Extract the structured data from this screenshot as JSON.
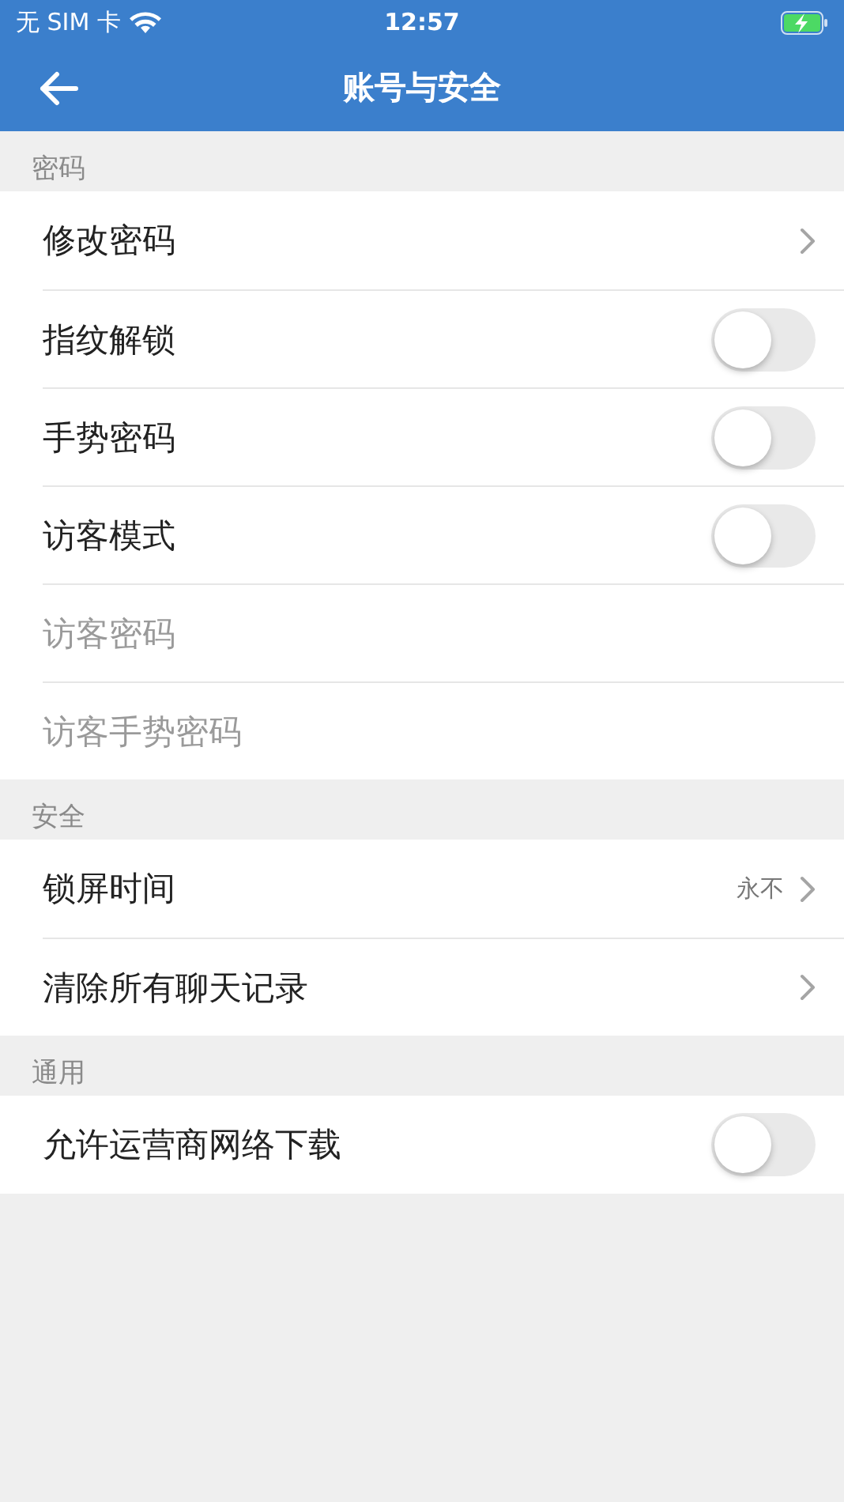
{
  "status_bar": {
    "carrier": "无 SIM 卡",
    "time": "12:57"
  },
  "nav_bar": {
    "title": "账号与安全"
  },
  "sections": [
    {
      "header": "密码",
      "rows": [
        {
          "kind": "link",
          "label": "修改密码",
          "disabled": false
        },
        {
          "kind": "toggle",
          "label": "指纹解锁",
          "on": false,
          "disabled": false
        },
        {
          "kind": "toggle",
          "label": "手势密码",
          "on": false,
          "disabled": false
        },
        {
          "kind": "toggle",
          "label": "访客模式",
          "on": false,
          "disabled": false
        },
        {
          "kind": "plain",
          "label": "访客密码",
          "disabled": true
        },
        {
          "kind": "plain",
          "label": "访客手势密码",
          "disabled": true
        }
      ]
    },
    {
      "header": "安全",
      "rows": [
        {
          "kind": "link",
          "label": "锁屏时间",
          "value": "永不",
          "disabled": false
        },
        {
          "kind": "link",
          "label": "清除所有聊天记录",
          "disabled": false
        }
      ]
    },
    {
      "header": "通用",
      "rows": [
        {
          "kind": "toggle",
          "label": "允许运营商网络下载",
          "on": false,
          "disabled": false
        }
      ]
    }
  ]
}
